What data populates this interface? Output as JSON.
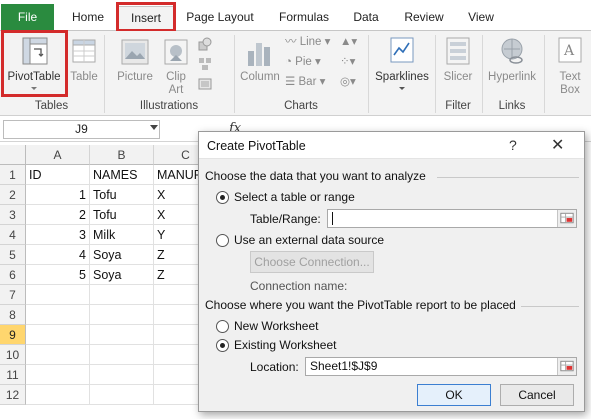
{
  "ribbon_tabs": [
    {
      "label": "File"
    },
    {
      "label": "Home"
    },
    {
      "label": "Insert"
    },
    {
      "label": "Page Layout"
    },
    {
      "label": "Formulas"
    },
    {
      "label": "Data"
    },
    {
      "label": "Review"
    },
    {
      "label": "View"
    }
  ],
  "ribbon": {
    "pivottable": "PivotTable",
    "table": "Table",
    "tables_group": "Tables",
    "picture": "Picture",
    "clip_art": "Clip\nArt",
    "illustrations_group": "Illustrations",
    "column": "Column",
    "line": "Line",
    "pie": "Pie",
    "bar": "Bar",
    "charts_group": "Charts",
    "sparklines": "Sparklines",
    "slicer": "Slicer",
    "filter_group": "Filter",
    "hyperlink": "Hyperlink",
    "links_group": "Links",
    "text_box": "Text\nBox"
  },
  "formula_bar": {
    "name_box": "J9",
    "fx": "fx"
  },
  "sheet": {
    "columns": [
      "A",
      "B",
      "C"
    ],
    "rows": [
      "1",
      "2",
      "3",
      "4",
      "5",
      "6",
      "7",
      "8",
      "9",
      "10",
      "11",
      "12"
    ],
    "selected_row": "9",
    "data": [
      [
        "ID",
        "NAMES",
        "MANUF"
      ],
      [
        "1",
        "Tofu",
        "X"
      ],
      [
        "2",
        "Tofu",
        "X"
      ],
      [
        "3",
        "Milk",
        "Y"
      ],
      [
        "4",
        "Soya",
        "Z"
      ],
      [
        "5",
        "Soya",
        "Z"
      ]
    ]
  },
  "dialog": {
    "title": "Create PivotTable",
    "help": "?",
    "close": "✕",
    "section1": "Choose the data that you want to analyze",
    "opt_select_table": "Select a table or range",
    "table_range_label": "Table/Range:",
    "table_range_value": "",
    "opt_external": "Use an external data source",
    "choose_connection": "Choose Connection...",
    "connection_name_label": "Connection name:",
    "section2": "Choose where you want the PivotTable report to be placed",
    "opt_new_ws": "New Worksheet",
    "opt_existing_ws": "Existing Worksheet",
    "location_label": "Location:",
    "location_value": "Sheet1!$J$9",
    "ok": "OK",
    "cancel": "Cancel"
  },
  "colors": {
    "file_tab": "#2a8b3f",
    "highlight_box": "#d32b2b",
    "selected_row_header": "#ffd66e"
  }
}
